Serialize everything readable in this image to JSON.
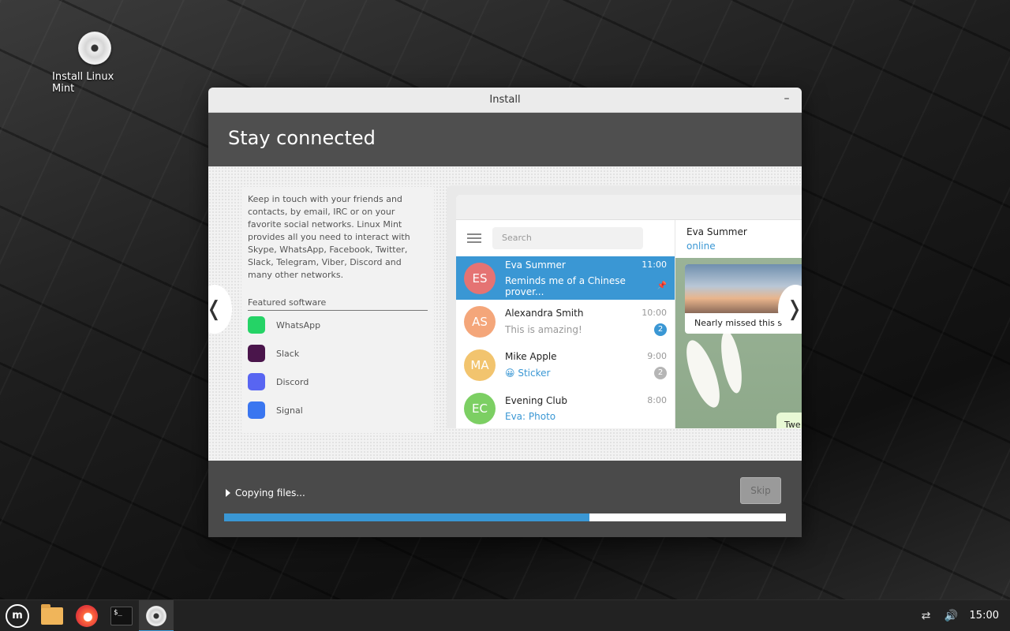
{
  "desktop": {
    "icon_label": "Install Linux Mint"
  },
  "window": {
    "title": "Install",
    "minimize_glyph": "–",
    "header_title": "Stay connected"
  },
  "slide": {
    "description": "Keep in touch with your friends and contacts, by email, IRC or on your favorite social networks. Linux Mint provides all you need to interact with Skype, WhatsApp, Facebook, Twitter, Slack, Telegram, Viber, Discord and many other networks.",
    "featured_title": "Featured software",
    "apps": [
      {
        "name": "WhatsApp",
        "icon": "whatsapp-icon",
        "color": "#25d366"
      },
      {
        "name": "Slack",
        "icon": "slack-icon",
        "color": "#4a154b"
      },
      {
        "name": "Discord",
        "icon": "discord-icon",
        "color": "#5865f2"
      },
      {
        "name": "Signal",
        "icon": "signal-icon",
        "color": "#3a76f0"
      }
    ],
    "prev_glyph": "❬",
    "next_glyph": "❭"
  },
  "telegram": {
    "search_placeholder": "Search",
    "chats": [
      {
        "initials": "ES",
        "name": "Eva Summer",
        "time": "11:00",
        "message": "Reminds me of a Chinese prover...",
        "color": "#e57373",
        "active": true
      },
      {
        "initials": "AS",
        "name": "Alexandra Smith",
        "time": "10:00",
        "message": "This is amazing!",
        "badge": "2",
        "color": "#f4a67a"
      },
      {
        "initials": "MA",
        "name": "Mike Apple",
        "time": "9:00",
        "message": "😀 Sticker",
        "badge": "2",
        "color": "#f2c46e"
      },
      {
        "initials": "EC",
        "name": "Evening Club",
        "time": "8:00",
        "message": "Eva: Photo",
        "color": "#7ccf63"
      }
    ],
    "chat_header_name": "Eva Summer",
    "chat_header_status": "online",
    "photo_caption": "Nearly missed this s",
    "bubble_text": "Twe"
  },
  "footer": {
    "status": "Copying files...",
    "skip_label": "Skip",
    "progress": 0.65
  },
  "taskbar": {
    "clock": "15:00"
  },
  "colors": {
    "accent": "#3a97d4"
  }
}
